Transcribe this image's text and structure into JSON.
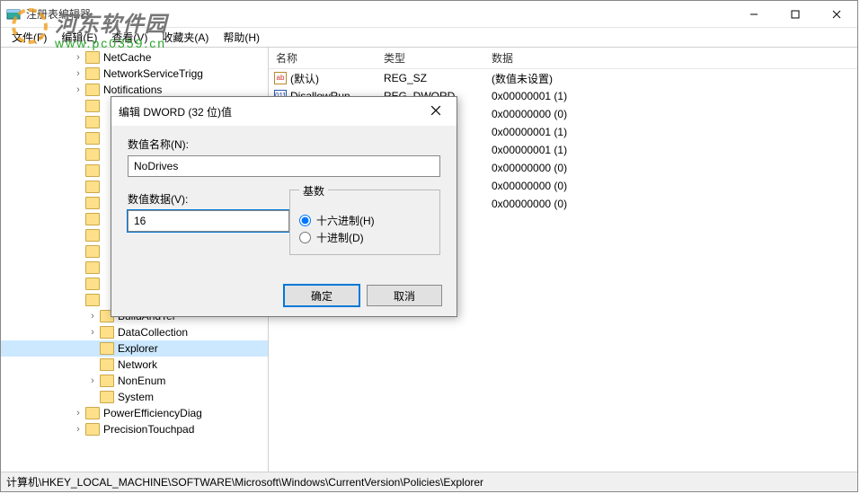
{
  "app": {
    "title": "注册表编辑器"
  },
  "watermark": {
    "line1": "河东软件园",
    "line2": "www.pc0359.cn"
  },
  "menu": {
    "file": "文件(F)",
    "edit": "编辑(E)",
    "view": "查看(V)",
    "fav": "收藏夹(A)",
    "help": "帮助(H)"
  },
  "tree": {
    "items": [
      {
        "indent": 5,
        "exp": "›",
        "label": "NetCache"
      },
      {
        "indent": 5,
        "exp": "›",
        "label": "NetworkServiceTrigg"
      },
      {
        "indent": 5,
        "exp": "›",
        "label": "Notifications"
      },
      {
        "indent": 5,
        "exp": "",
        "label": ""
      },
      {
        "indent": 5,
        "exp": "",
        "label": ""
      },
      {
        "indent": 5,
        "exp": "",
        "label": ""
      },
      {
        "indent": 5,
        "exp": "",
        "label": ""
      },
      {
        "indent": 5,
        "exp": "",
        "label": ""
      },
      {
        "indent": 5,
        "exp": "",
        "label": ""
      },
      {
        "indent": 5,
        "exp": "",
        "label": ""
      },
      {
        "indent": 5,
        "exp": "",
        "label": ""
      },
      {
        "indent": 5,
        "exp": "",
        "label": ""
      },
      {
        "indent": 5,
        "exp": "",
        "label": ""
      },
      {
        "indent": 5,
        "exp": "",
        "label": ""
      },
      {
        "indent": 5,
        "exp": "",
        "label": ""
      },
      {
        "indent": 5,
        "exp": "",
        "label": ""
      },
      {
        "indent": 6,
        "exp": "›",
        "label": "BuildAndTel"
      },
      {
        "indent": 6,
        "exp": "›",
        "label": "DataCollection"
      },
      {
        "indent": 6,
        "exp": "",
        "label": "Explorer",
        "selected": true
      },
      {
        "indent": 6,
        "exp": "",
        "label": "Network"
      },
      {
        "indent": 6,
        "exp": "›",
        "label": "NonEnum"
      },
      {
        "indent": 6,
        "exp": "",
        "label": "System"
      },
      {
        "indent": 5,
        "exp": "›",
        "label": "PowerEfficiencyDiag"
      },
      {
        "indent": 5,
        "exp": "›",
        "label": "PrecisionTouchpad"
      }
    ]
  },
  "list": {
    "headers": {
      "name": "名称",
      "type": "类型",
      "data": "数据"
    },
    "rows": [
      {
        "icon": "sz",
        "name": "(默认)",
        "type": "REG_SZ",
        "data": "(数值未设置)"
      },
      {
        "icon": "dw",
        "name": "DisallowRun",
        "type": "REG_DWORD",
        "data": "0x00000001 (1)"
      },
      {
        "icon": "",
        "name": "",
        "type": "",
        "data": "0x00000000 (0)"
      },
      {
        "icon": "",
        "name": "",
        "type": "",
        "data": "0x00000001 (1)"
      },
      {
        "icon": "",
        "name": "",
        "type": "",
        "data": "0x00000001 (1)"
      },
      {
        "icon": "",
        "name": "",
        "type": "",
        "data": "0x00000000 (0)"
      },
      {
        "icon": "",
        "name": "",
        "type": "",
        "data": "0x00000000 (0)"
      },
      {
        "icon": "",
        "name": "",
        "type": "",
        "data": "0x00000000 (0)"
      }
    ]
  },
  "status": {
    "path": "计算机\\HKEY_LOCAL_MACHINE\\SOFTWARE\\Microsoft\\Windows\\CurrentVersion\\Policies\\Explorer"
  },
  "dialog": {
    "title": "编辑 DWORD (32 位)值",
    "name_label": "数值名称(N):",
    "name_value": "NoDrives",
    "data_label": "数值数据(V):",
    "data_value": "16",
    "base_label": "基数",
    "radix_hex": "十六进制(H)",
    "radix_dec": "十进制(D)",
    "ok": "确定",
    "cancel": "取消"
  }
}
